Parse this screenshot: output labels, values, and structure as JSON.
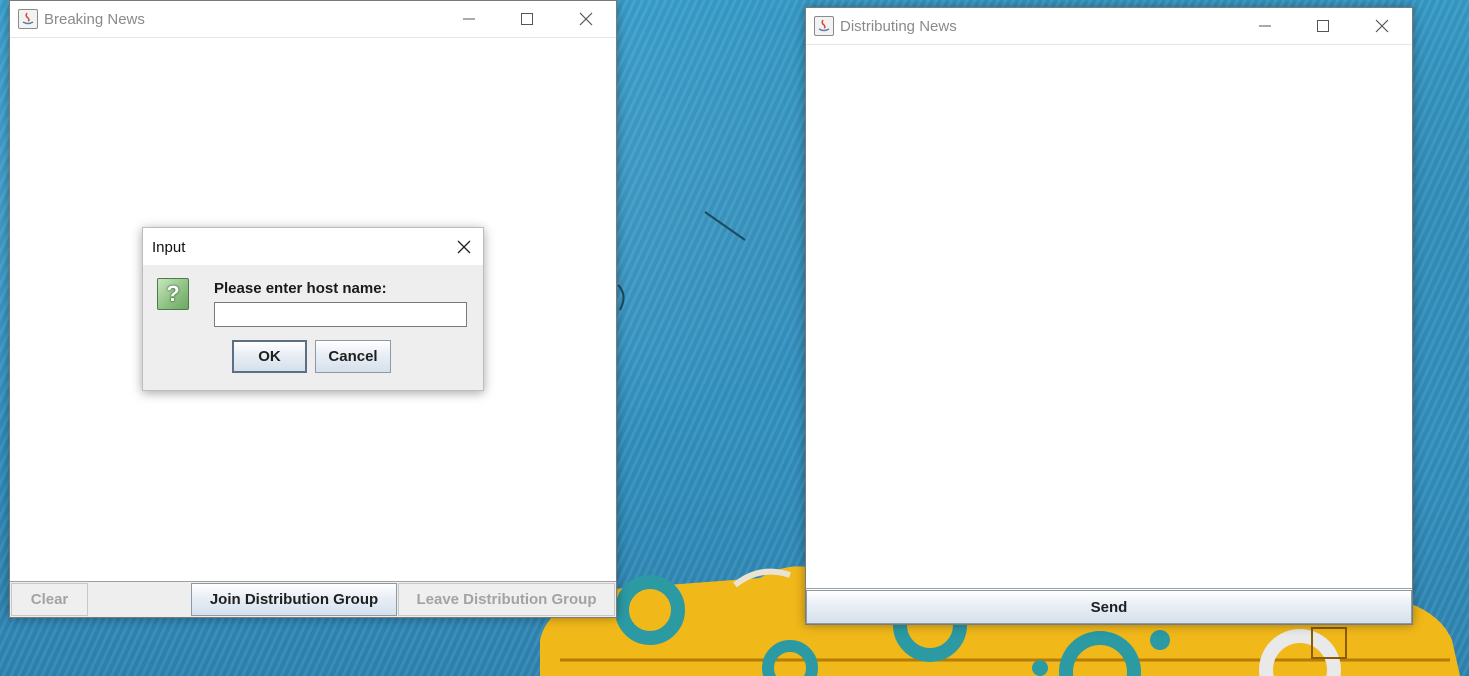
{
  "windows": {
    "breaking": {
      "title": "Breaking News",
      "buttons": {
        "clear": "Clear",
        "join": "Join Distribution Group",
        "leave": "Leave Distribution Group"
      }
    },
    "distributing": {
      "title": "Distributing News",
      "buttons": {
        "send": "Send"
      }
    }
  },
  "dialog": {
    "title": "Input",
    "prompt": "Please enter host name:",
    "input_value": "",
    "ok": "OK",
    "cancel": "Cancel",
    "icon": "question-icon",
    "icon_glyph": "?"
  },
  "colors": {
    "desktop": "#3a9bc9",
    "button_gradient_end": "#d6e1ec",
    "disabled_text": "#a3a3a3"
  }
}
